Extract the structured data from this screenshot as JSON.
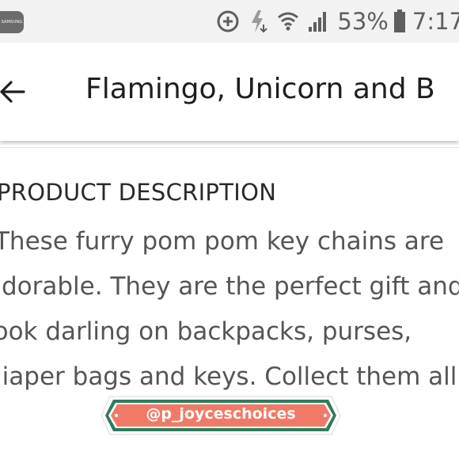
{
  "status_bar": {
    "battery_percent": "53%",
    "time": "7:17",
    "logo_text": "SAMSUNG",
    "icons": [
      "samsung-logo",
      "data-saver-icon",
      "flash-download-icon",
      "wifi-icon",
      "signal-icon",
      "battery-icon"
    ]
  },
  "app_bar": {
    "back_icon": "arrow-left-icon",
    "title": "Flamingo, Unicorn and B"
  },
  "content": {
    "heading": "PRODUCT DESCRIPTION",
    "description_lines": [
      "These furry pom pom key chains are",
      "adorable. They are the perfect  gift and",
      "look darling on backpacks, purses,",
      "diaper bags and keys. Collect them all"
    ]
  },
  "watermark": {
    "text": "@p_joyceschoices"
  },
  "colors": {
    "status_bar_bg": "#f2f2f2",
    "text_dark": "#1e1e1e",
    "text_body": "#555555",
    "watermark_fill": "#f07a66",
    "watermark_border": "#2e7d5b"
  }
}
